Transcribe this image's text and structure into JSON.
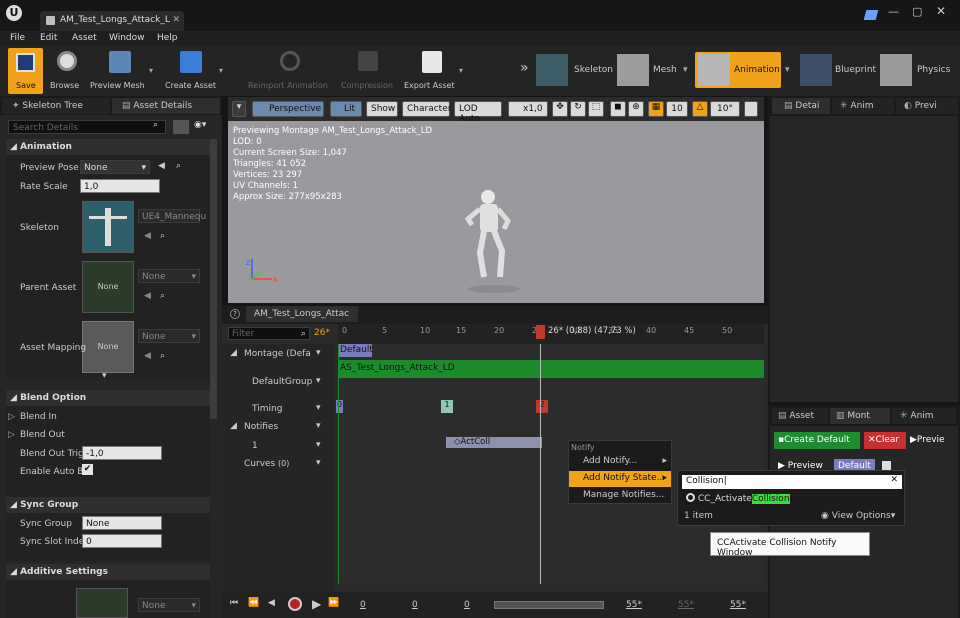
{
  "window": {
    "tab_title": "AM_Test_Longs_Attack_L"
  },
  "menu": [
    "File",
    "Edit",
    "Asset",
    "Window",
    "Help"
  ],
  "toolbar": {
    "save": "Save",
    "browse": "Browse",
    "preview_mesh": "Preview Mesh",
    "create_asset": "Create Asset",
    "reimport": "Reimport Animation",
    "compression": "Compression",
    "export": "Export Asset"
  },
  "modes": {
    "skeleton": "Skeleton",
    "mesh": "Mesh",
    "animation": "Animation",
    "blueprint": "Blueprint",
    "physics": "Physics"
  },
  "left_tabs": {
    "skeleton_tree": "Skeleton Tree",
    "asset_details": "Asset Details"
  },
  "details": {
    "search_placeholder": "Search Details",
    "animation_header": "Animation",
    "preview_pose_label": "Preview Pose A",
    "preview_pose_value": "None",
    "rate_scale_label": "Rate Scale",
    "rate_scale_value": "1,0",
    "skeleton_label": "Skeleton",
    "skeleton_value": "UE4_Mannequ",
    "parent_asset_label": "Parent Asset",
    "parent_asset_thumb": "None",
    "parent_asset_value": "None",
    "asset_mapping_label": "Asset Mapping",
    "asset_mapping_thumb": "None",
    "asset_mapping_value": "None",
    "blend_header": "Blend Option",
    "blend_in": "Blend In",
    "blend_out": "Blend Out",
    "blend_out_trigger_label": "Blend Out Trigg",
    "blend_out_trigger_value": "-1,0",
    "enable_auto_blend": "Enable Auto Ble",
    "sync_header": "Sync Group",
    "sync_group_label": "Sync Group",
    "sync_group_value": "None",
    "sync_slot_label": "Sync Slot Index",
    "sync_slot_value": "0",
    "additive_header": "Additive Settings",
    "additive_value": "None"
  },
  "viewport": {
    "perspective": "Perspective",
    "lit": "Lit",
    "show": "Show",
    "character": "Character",
    "lod": "LOD Auto",
    "speed": "x1,0",
    "grid_snap": "10",
    "rot_snap": "10°",
    "info": [
      "Previewing Montage AM_Test_Longs_Attack_LD",
      "LOD: 0",
      "Current Screen Size: 1,047",
      "Triangles: 41 052",
      "Vertices: 23 297",
      "UV Channels: 1",
      "Approx Size: 277x95x283"
    ]
  },
  "montage": {
    "tab": "AM_Test_Longs_Attac",
    "filter_placeholder": "Filter",
    "frame_marker": "26*",
    "playhead_label": "26* (0,88) (47,73 %)",
    "ticks": [
      "0",
      "5",
      "10",
      "15",
      "20",
      "25",
      "30",
      "35",
      "40",
      "45",
      "50"
    ],
    "rows": {
      "montage": "Montage (Defa",
      "default_group": "DefaultGroup",
      "timing": "Timing",
      "notifies": "Notifies",
      "notify_track": "1",
      "curves": "Curves",
      "curves_count": "(0)"
    },
    "default_section": "Default",
    "anim_segment": "AS_Test_Longs_Attack_LD",
    "timing_markers": [
      "0",
      "1",
      "2"
    ],
    "notify_name": "ActColl"
  },
  "playback": {
    "frame_a": "0",
    "frame_b": "0",
    "frame_c": "0",
    "end_a": "55*",
    "end_b": "55*",
    "end_c": "55*"
  },
  "right_top_tabs": [
    "Detai",
    "Anim",
    "Previ"
  ],
  "right_bottom_tabs": [
    "Asset",
    "Mont",
    "Anim"
  ],
  "right_buttons": {
    "create_default": "Create Default",
    "clear": "Clear",
    "preview": "Preview",
    "preview2": "Previe",
    "default": "Default"
  },
  "context_menu": {
    "header": "Notify",
    "items": [
      "Add Notify...",
      "Add Notify State...",
      "Manage Notifies..."
    ]
  },
  "picker": {
    "search": "Collision",
    "result_prefix": "CC_Activate",
    "result_highlight": "Collision",
    "count": "1 item",
    "view_options": "View Options"
  },
  "tooltip": "CCActivate Collision Notify Window",
  "colors": {
    "accent": "#f5a623",
    "green_track": "#1c8c2a",
    "section": "#7b7bc0",
    "highlight": "#3ddc3d",
    "clear": "#c53030"
  }
}
